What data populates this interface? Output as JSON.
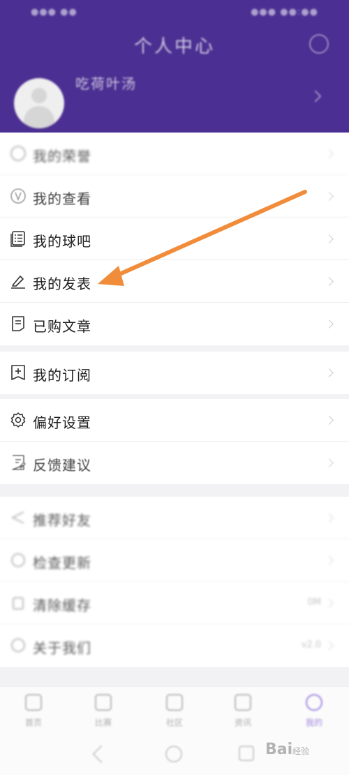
{
  "status_bar": {
    "left": "●●● ●●",
    "right": "●●● ●●:●●"
  },
  "header": {
    "title": "个人中心",
    "username": "吃荷叶汤"
  },
  "menu_blurred_top": {
    "label": "我的荣誉"
  },
  "menu_group_1": [
    {
      "label": "我的查看",
      "icon": "v-circle-icon"
    },
    {
      "label": "我的球吧",
      "icon": "list-icon"
    },
    {
      "label": "我的发表",
      "icon": "pen-icon"
    },
    {
      "label": "已购文章",
      "icon": "article-icon"
    }
  ],
  "menu_group_2": [
    {
      "label": "我的订阅",
      "icon": "plus-box-icon"
    }
  ],
  "menu_group_3": [
    {
      "label": "偏好设置",
      "icon": "gear-icon"
    },
    {
      "label": "反馈建议",
      "icon": "feedback-icon"
    }
  ],
  "menu_group_4": [
    {
      "label": "推荐好友",
      "value": ""
    },
    {
      "label": "检查更新",
      "value": ""
    },
    {
      "label": "清除缓存",
      "value": "0M"
    },
    {
      "label": "关于我们",
      "value": "v2.0"
    }
  ],
  "tabs": [
    {
      "label": "首页"
    },
    {
      "label": "比赛"
    },
    {
      "label": "社区"
    },
    {
      "label": "资讯"
    },
    {
      "label": "我的"
    }
  ],
  "watermark": {
    "text": "Bai",
    "suffix": "经验"
  },
  "colors": {
    "header": "#4b2f92",
    "arrow": "#f08c3a",
    "accent": "#7a55d6"
  }
}
